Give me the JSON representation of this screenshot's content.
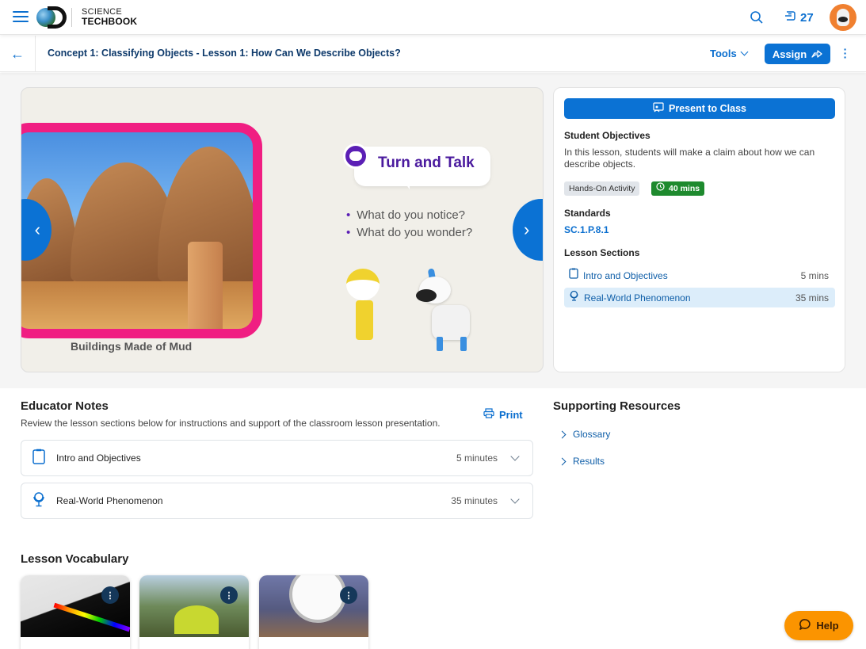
{
  "header": {
    "logo_line1": "SCIENCE",
    "logo_line2": "TECHBOOK",
    "notification_count": "27",
    "icons": {
      "menu": "hamburger-icon",
      "search": "search-icon",
      "notifications": "inbox-icon",
      "avatar": "dog-avatar"
    }
  },
  "lesson_bar": {
    "title": "Concept 1: Classifying Objects - Lesson 1: How Can We Describe Objects?",
    "tools_label": "Tools",
    "assign_label": "Assign"
  },
  "slide": {
    "photo_caption": "Buildings Made of Mud",
    "talk_title": "Turn and Talk",
    "questions": [
      "What do you notice?",
      "What do you wonder?"
    ]
  },
  "info_panel": {
    "present_label": "Present to Class",
    "objectives_label": "Student Objectives",
    "objectives_text": "In this lesson, students will make a claim about how we can describe objects.",
    "activity_badge": "Hands-On Activity",
    "time_badge": "40 mins",
    "standards_label": "Standards",
    "standard_code": "SC.1.P.8.1",
    "sections_label": "Lesson Sections",
    "sections": [
      {
        "name": "Intro and Objectives",
        "duration": "5 mins",
        "icon": "clipboard-icon",
        "active": false
      },
      {
        "name": "Real-World Phenomenon",
        "duration": "35 mins",
        "icon": "globe-stand-icon",
        "active": true
      }
    ]
  },
  "educator_notes": {
    "title": "Educator Notes",
    "subtitle": "Review the lesson sections below for instructions and support of the classroom lesson presentation.",
    "print_label": "Print",
    "items": [
      {
        "name": "Intro and Objectives",
        "duration": "5 minutes"
      },
      {
        "name": "Real-World Phenomenon",
        "duration": "35 minutes"
      }
    ]
  },
  "supporting_resources": {
    "title": "Supporting Resources",
    "items": [
      "Glossary",
      "Results"
    ]
  },
  "vocabulary": {
    "title": "Lesson Vocabulary",
    "cards": [
      {
        "image": "prism-light-spectrum"
      },
      {
        "image": "tent-in-forest"
      },
      {
        "image": "hanging-scale"
      }
    ]
  },
  "help": {
    "label": "Help"
  },
  "colors": {
    "primary": "#0b72d4",
    "navy": "#0e3a6b",
    "green": "#1e8a2e",
    "help_orange": "#fb9400",
    "slide_pink": "#f01e82",
    "talk_purple": "#4a1a9e"
  }
}
